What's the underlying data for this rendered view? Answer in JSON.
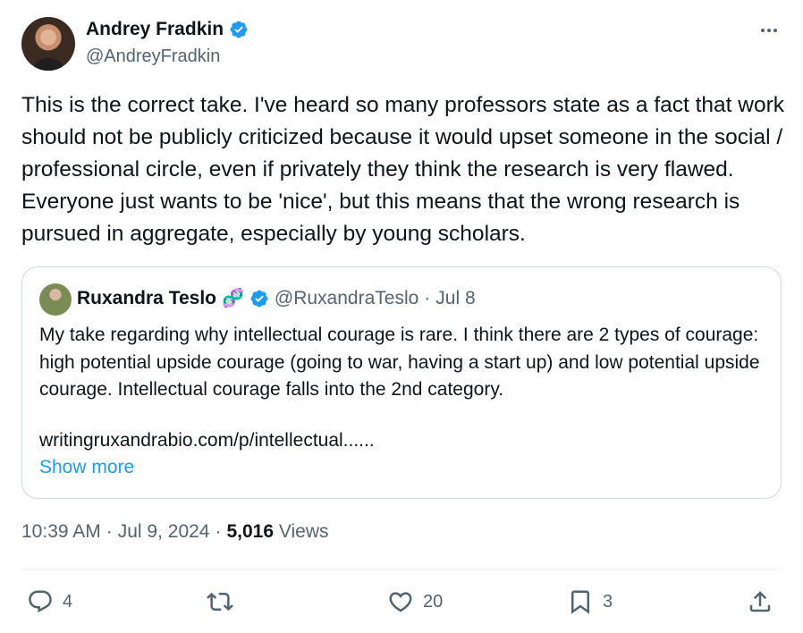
{
  "author": {
    "name": "Andrey Fradkin",
    "handle": "@AndreyFradkin",
    "verified": true
  },
  "tweet": {
    "text": "This is the correct take. I've heard so many professors state as a fact that work should not be publicly criticized because it would upset someone in the social / professional circle, even if privately they think the research is very flawed. Everyone just wants to be 'nice', but this means that the wrong research is pursued in aggregate, especially by young scholars."
  },
  "quote": {
    "name": "Ruxandra Teslo",
    "emoji": "🧬",
    "handle": "@RuxandraTeslo",
    "separator": "·",
    "date": "Jul 8",
    "text": "My take regarding why intellectual courage is rare. I think there are 2 types of courage: high potential upside courage (going to war, having a start up) and low potential upside courage. Intellectual courage falls into the 2nd category.",
    "link": "writingruxandrabio.com/p/intellectual......",
    "show_more": "Show more"
  },
  "meta": {
    "time": "10:39 AM",
    "sep1": "·",
    "date": "Jul 9, 2024",
    "sep2": "·",
    "views_count": "5,016",
    "views_label": "Views"
  },
  "actions": {
    "replies": "4",
    "retweets": "",
    "likes": "20",
    "bookmarks": "3"
  },
  "icons": {
    "more": "more-icon",
    "verified": "verified-badge-icon",
    "reply": "reply-icon",
    "retweet": "retweet-icon",
    "like": "heart-icon",
    "bookmark": "bookmark-icon",
    "share": "share-icon"
  },
  "colors": {
    "text": "#0f1419",
    "secondary": "#536471",
    "accent": "#1d9bf0",
    "border": "#cfd9de"
  }
}
